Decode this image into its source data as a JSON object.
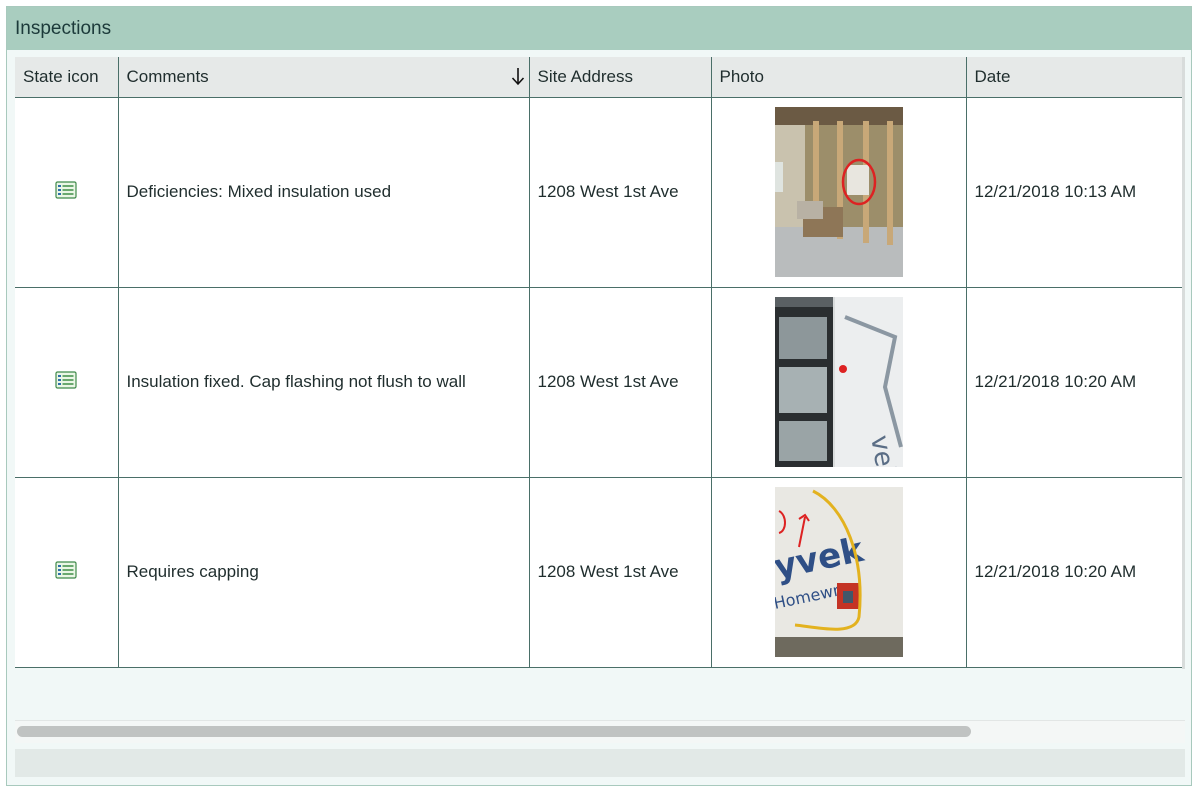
{
  "panel": {
    "title": "Inspections"
  },
  "columns": {
    "state_icon": "State icon",
    "comments": "Comments",
    "site_address": "Site Address",
    "photo": "Photo",
    "date": "Date",
    "sort_indicator": "descending"
  },
  "rows": [
    {
      "state_icon": "form-icon",
      "comments": "Deficiencies: Mixed insulation used",
      "site_address": "1208 West 1st Ave",
      "photo": "interior-framing-photo",
      "date": "12/21/2018 10:13 AM"
    },
    {
      "state_icon": "form-icon",
      "comments": "Insulation fixed. Cap flashing not flush to wall",
      "site_address": "1208 West 1st Ave",
      "photo": "window-wrap-photo",
      "date": "12/21/2018 10:20 AM"
    },
    {
      "state_icon": "form-icon",
      "comments": "Requires capping",
      "site_address": "1208 West 1st Ave",
      "photo": "tyvek-wire-photo",
      "date": "12/21/2018 10:20 AM"
    }
  ],
  "colors": {
    "title_bar": "#a9cdbf",
    "panel_bg": "#f1f8f7",
    "grid_line": "#4a6f68",
    "header_bg": "#e6e9e8"
  }
}
